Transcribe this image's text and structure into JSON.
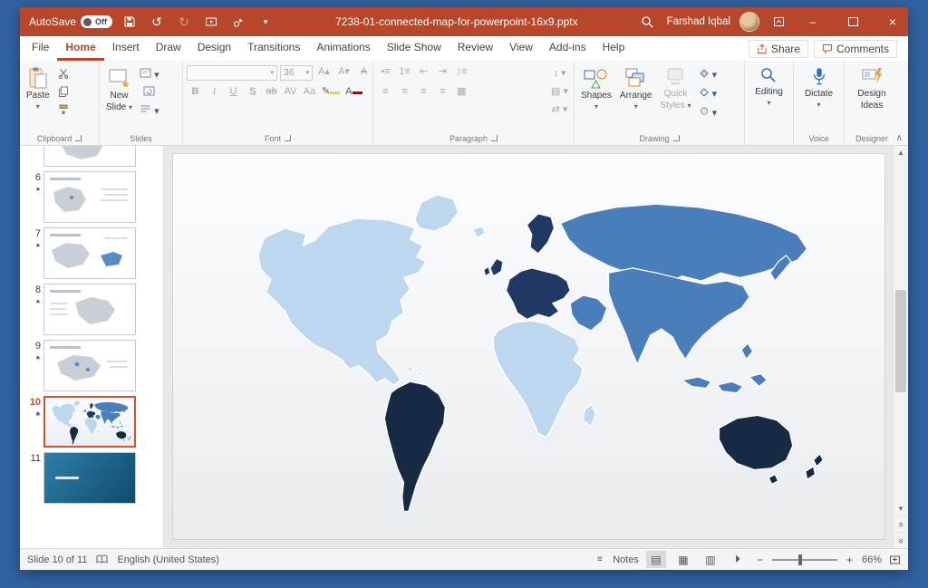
{
  "colors": {
    "desktop_bg": "#31619F",
    "titlebar_bg": "#B7472A",
    "accent": "#C24A32",
    "map_light": "#BDD7EE",
    "map_medium": "#4A7EBB",
    "map_dark": "#1F3864",
    "map_darkest": "#162A44",
    "map_stroke": "#FFFFFF"
  },
  "titlebar": {
    "autosave_label": "AutoSave",
    "autosave_state": "Off",
    "title": "7238-01-connected-map-for-powerpoint-16x9.pptx",
    "user_name": "Farshad Iqbal"
  },
  "menubar": {
    "tabs": [
      "File",
      "Home",
      "Insert",
      "Draw",
      "Design",
      "Transitions",
      "Animations",
      "Slide Show",
      "Review",
      "View",
      "Add-ins",
      "Help"
    ],
    "share": "Share",
    "comments": "Comments"
  },
  "ribbon": {
    "paste": "Paste",
    "new_slide_1": "New",
    "new_slide_2": "Slide",
    "font_size": "36",
    "bold": "B",
    "italic": "I",
    "underline": "U",
    "shadow": "S",
    "shapes": "Shapes",
    "arrange": "Arrange",
    "quick_1": "Quick",
    "quick_2": "Styles",
    "editing": "Editing",
    "dictate": "Dictate",
    "design_1": "Design",
    "design_2": "Ideas",
    "groups": {
      "clipboard": "Clipboard",
      "slides": "Slides",
      "font": "Font",
      "paragraph": "Paragraph",
      "drawing": "Drawing",
      "voice": "Voice",
      "designer": "Designer"
    }
  },
  "slides": {
    "items": [
      {
        "number": "6"
      },
      {
        "number": "7"
      },
      {
        "number": "8"
      },
      {
        "number": "9"
      },
      {
        "number": "10"
      },
      {
        "number": "11"
      }
    ]
  },
  "statusbar": {
    "slide_info": "Slide 10 of 11",
    "language": "English (United States)",
    "notes": "Notes",
    "zoom": "66%"
  }
}
